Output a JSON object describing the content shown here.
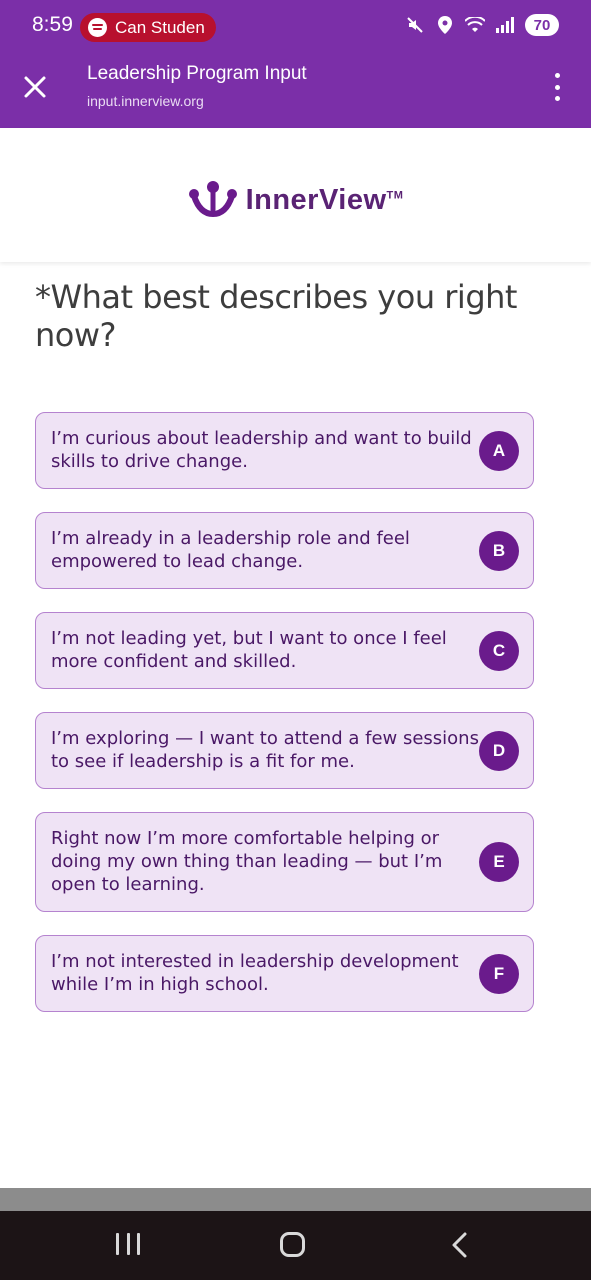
{
  "status_bar": {
    "time": "8:59",
    "media_label": "Can Studen",
    "battery": "70"
  },
  "browser": {
    "title": "Leadership Program Input",
    "url": "input.innerview.org"
  },
  "logo": {
    "text": "InnerView",
    "tm": "TM"
  },
  "question": "*What best describes you right now?",
  "options": [
    {
      "key": "A",
      "text": "I’m curious about leadership and want to build skills to drive change."
    },
    {
      "key": "B",
      "text": "I’m already in a leadership role and feel empowered to lead change."
    },
    {
      "key": "C",
      "text": "I’m not leading yet, but I want to once I feel more confident and skilled."
    },
    {
      "key": "D",
      "text": "I’m exploring — I want to attend a few sessions to see if leadership is a fit for me."
    },
    {
      "key": "E",
      "text": "Right now I’m more comfortable helping or doing my own thing than leading — but I’m open to learning."
    },
    {
      "key": "F",
      "text": "I’m not interested in leadership development while I’m in high school."
    }
  ],
  "colors": {
    "header": "#7b2fa8",
    "option_bg": "#efe3f5",
    "option_border": "#b583cf",
    "key_circle": "#6a1b8c",
    "option_text": "#4a1866"
  }
}
